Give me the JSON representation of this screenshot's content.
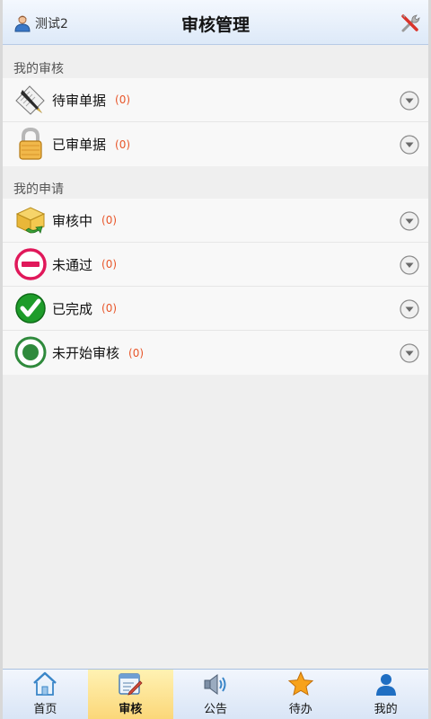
{
  "header": {
    "user_name": "测试2",
    "title": "审核管理"
  },
  "sections": [
    {
      "label": "我的审核",
      "items": [
        {
          "label": "待审单据",
          "count": "(0)",
          "icon": "pen-document-icon"
        },
        {
          "label": "已审单据",
          "count": "(0)",
          "icon": "lock-icon"
        }
      ]
    },
    {
      "label": "我的申请",
      "items": [
        {
          "label": "审核中",
          "count": "(0)",
          "icon": "box-refresh-icon"
        },
        {
          "label": "未通过",
          "count": "(0)",
          "icon": "minus-circle-icon"
        },
        {
          "label": "已完成",
          "count": "(0)",
          "icon": "check-circle-icon"
        },
        {
          "label": "未开始审核",
          "count": "(0)",
          "icon": "record-circle-icon"
        }
      ]
    }
  ],
  "tabbar": [
    {
      "label": "首页",
      "icon": "home-icon",
      "active": false
    },
    {
      "label": "审核",
      "icon": "edit-icon",
      "active": true
    },
    {
      "label": "公告",
      "icon": "speaker-icon",
      "active": false
    },
    {
      "label": "待办",
      "icon": "star-icon",
      "active": false
    },
    {
      "label": "我的",
      "icon": "person-icon",
      "active": false
    }
  ],
  "colors": {
    "count": "#e8562a",
    "active_tab": "#fbd779",
    "header": "#dde9f8"
  }
}
